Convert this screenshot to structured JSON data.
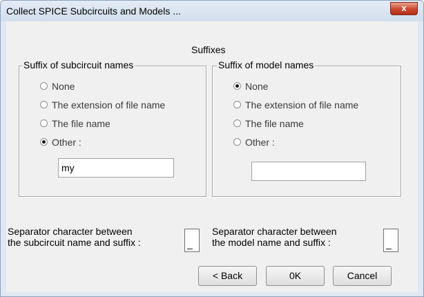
{
  "window": {
    "title": "Collect SPICE Subcircuits and Models ...",
    "close_symbol": "x"
  },
  "suffixes_title": "Suffixes",
  "subcircuit_group": {
    "label": "Suffix of subcircuit names",
    "options": [
      "None",
      "The extension of file name",
      "The file name",
      "Other :"
    ],
    "selected": "Other :",
    "other_value": "my"
  },
  "model_group": {
    "label": "Suffix of model names",
    "options": [
      "None",
      "The extension of file name",
      "The file name",
      "Other :"
    ],
    "selected": "None",
    "other_value": ""
  },
  "separator_subcircuit": {
    "line1": "Separator character between",
    "line2": "the subcircuit name and suffix :",
    "value": "_"
  },
  "separator_model": {
    "line1": "Separator character between",
    "line2": "the model name and suffix :",
    "value": "_"
  },
  "buttons": {
    "back": "< Back",
    "ok": "0K",
    "cancel": "Cancel"
  }
}
